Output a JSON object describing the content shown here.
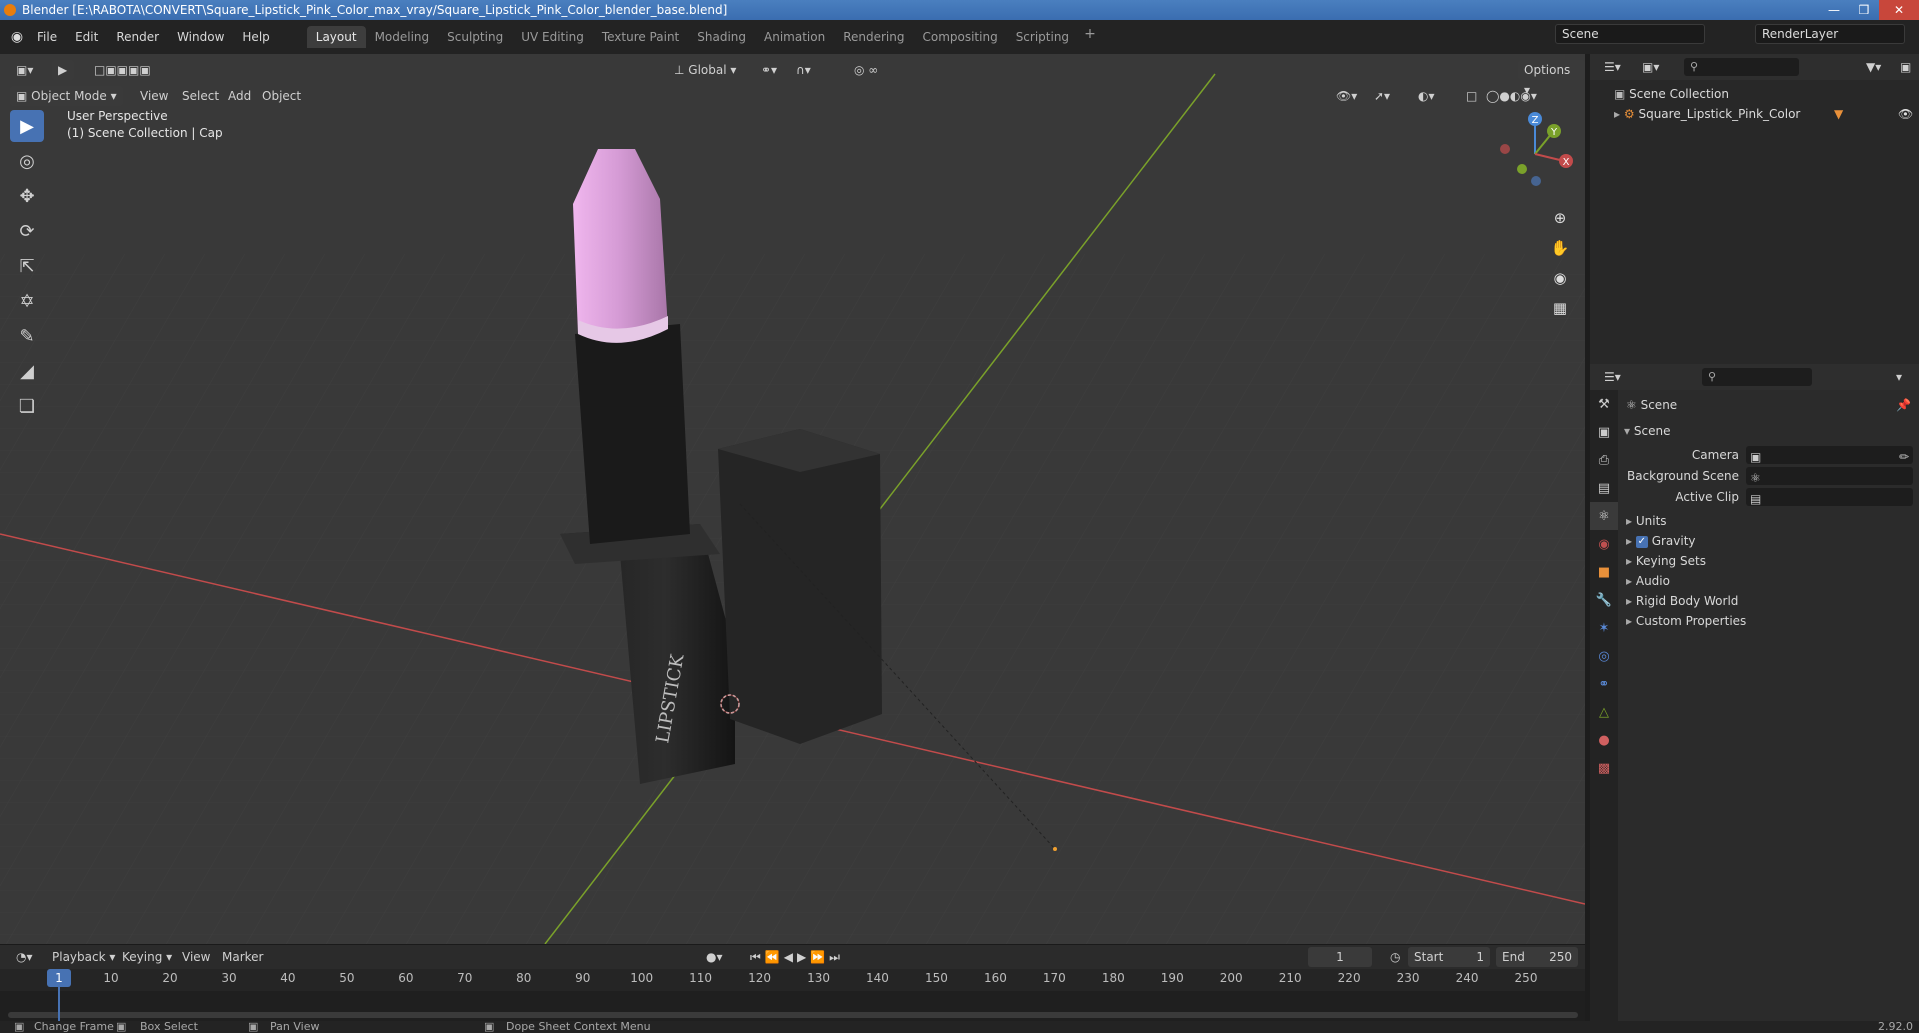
{
  "window": {
    "title": "Blender [E:\\RABOTA\\CONVERT\\Square_Lipstick_Pink_Color_max_vray/Square_Lipstick_Pink_Color_blender_base.blend]",
    "controls": [
      "—",
      "❒",
      "✕"
    ]
  },
  "menu": {
    "items": [
      "File",
      "Edit",
      "Render",
      "Window",
      "Help"
    ],
    "workspaces": [
      "Layout",
      "Modeling",
      "Sculpting",
      "UV Editing",
      "Texture Paint",
      "Shading",
      "Animation",
      "Rendering",
      "Compositing",
      "Scripting"
    ],
    "active_workspace": "Layout",
    "add_symbol": "+",
    "scene_name": "Scene",
    "render_layer": "RenderLayer"
  },
  "tool_header": {
    "transform_orientation": "Global",
    "options_label": "Options"
  },
  "viewport_header": {
    "mode": "Object Mode",
    "menus": [
      "View",
      "Select",
      "Add",
      "Object"
    ]
  },
  "viewport": {
    "perspective_label": "User Perspective",
    "collection_label": "(1) Scene Collection | Cap",
    "lipstick_text": "LIPSTICK",
    "gizmo_axes": [
      "Z",
      "Y",
      "X"
    ]
  },
  "left_tools": [
    "select-box",
    "cursor",
    "move",
    "rotate",
    "scale",
    "transform",
    "annotate",
    "measure",
    "add-cube"
  ],
  "timeline": {
    "menus": [
      "Playback",
      "Keying",
      "View",
      "Marker"
    ],
    "current_frame": "1",
    "start_label": "Start",
    "start_value": "1",
    "end_label": "End",
    "end_value": "250",
    "ticks": [
      "1",
      "10",
      "20",
      "30",
      "40",
      "50",
      "60",
      "70",
      "80",
      "90",
      "100",
      "110",
      "120",
      "130",
      "140",
      "150",
      "160",
      "170",
      "180",
      "190",
      "200",
      "210",
      "220",
      "230",
      "240",
      "250"
    ]
  },
  "statusbar": {
    "items": [
      "Change Frame",
      "Box Select",
      "Pan View",
      "Dope Sheet Context Menu"
    ],
    "version": "2.92.0"
  },
  "outliner": {
    "root": "Scene Collection",
    "items": [
      "Square_Lipstick_Pink_Color"
    ]
  },
  "properties": {
    "context": "Scene",
    "panel_title": "Scene",
    "fields": [
      {
        "label": "Camera"
      },
      {
        "label": "Background Scene"
      },
      {
        "label": "Active Clip"
      }
    ],
    "subpanels": [
      "Units",
      "Gravity",
      "Keying Sets",
      "Audio",
      "Rigid Body World",
      "Custom Properties"
    ],
    "gravity_checked": true
  },
  "colors": {
    "accent": "#4772b3",
    "x_axis": "#c24b4b",
    "y_axis": "#7aa12a",
    "lipstick_pink": "#d49ad4"
  }
}
